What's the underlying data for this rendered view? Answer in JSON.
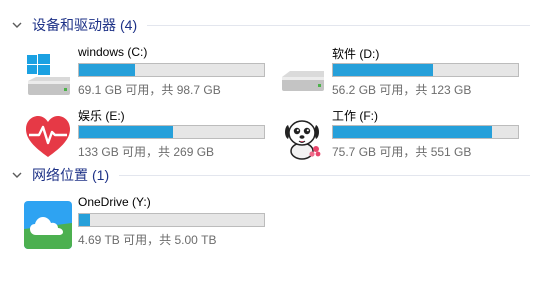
{
  "groups": {
    "devices": {
      "title": "设备和驱动器",
      "count": "(4)"
    },
    "network": {
      "title": "网络位置",
      "count": "(1)"
    }
  },
  "drives": [
    {
      "name": "windows (C:)",
      "free_text": "69.1 GB 可用，共 98.7 GB",
      "used_fraction": 0.3,
      "icon": "windows-drive-icon"
    },
    {
      "name": "软件 (D:)",
      "free_text": "56.2 GB 可用，共 123 GB",
      "used_fraction": 0.54,
      "icon": "hard-drive-icon"
    },
    {
      "name": "娱乐 (E:)",
      "free_text": "133 GB 可用，共 269 GB",
      "used_fraction": 0.51,
      "icon": "heart-pulse-icon"
    },
    {
      "name": "工作 (F:)",
      "free_text": "75.7 GB 可用，共 551 GB",
      "used_fraction": 0.86,
      "icon": "cartoon-dog-icon"
    },
    {
      "name": "OneDrive (Y:)",
      "free_text": "4.69 TB 可用，共 5.00 TB",
      "used_fraction": 0.06,
      "icon": "onedrive-cloud-icon"
    }
  ],
  "colors": {
    "accent": "#26a0da",
    "group_title": "#1e3287",
    "bar_track": "#e6e6e6",
    "secondary_text": "#6d6d6d"
  }
}
